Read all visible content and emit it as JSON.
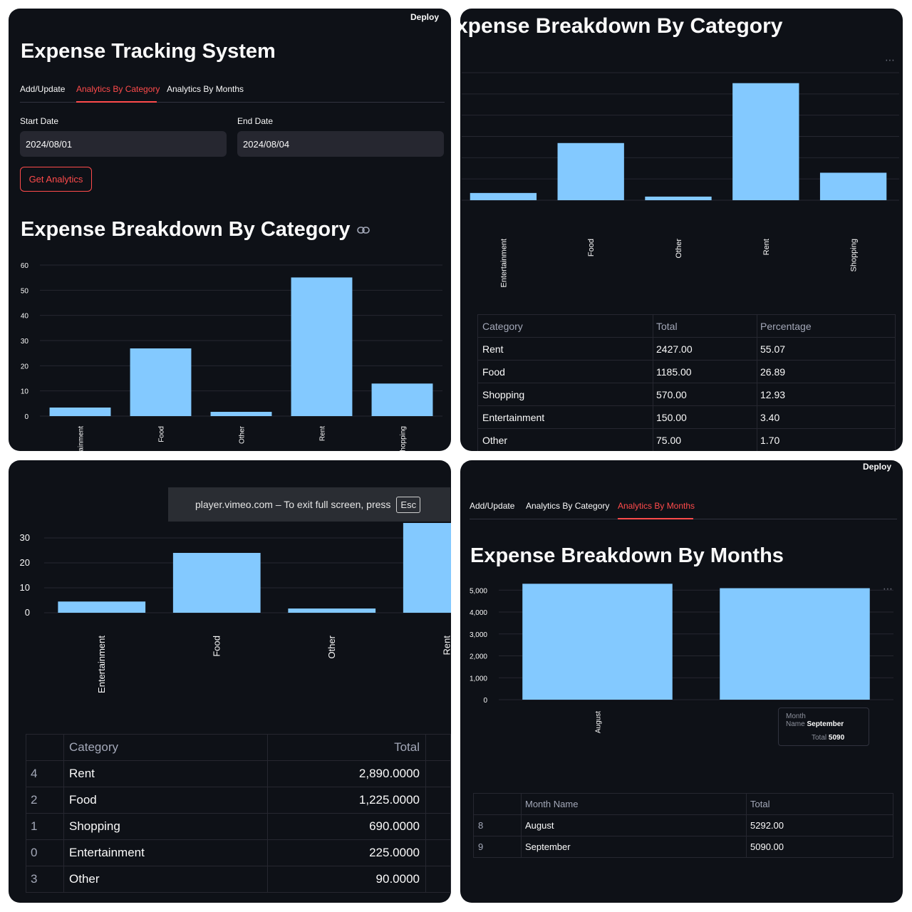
{
  "panel1": {
    "deploy": "Deploy",
    "title": "Expense Tracking System",
    "tabs": [
      {
        "label": "Add/Update",
        "active": false
      },
      {
        "label": "Analytics By Category",
        "active": true
      },
      {
        "label": "Analytics By Months",
        "active": false
      }
    ],
    "start_date_label": "Start Date",
    "start_date_value": "2024/08/01",
    "end_date_label": "End Date",
    "end_date_value": "2024/08/04",
    "get_analytics_button": "Get Analytics",
    "section_title": "Expense Breakdown By Category",
    "link_icon": "link-icon"
  },
  "panel2": {
    "section_title_partial": "xpense Breakdown By Category",
    "more_icon": "more-horizontal-icon",
    "table": {
      "headers": [
        "Category",
        "Total",
        "Percentage"
      ],
      "rows": [
        [
          "Rent",
          "2427.00",
          "55.07"
        ],
        [
          "Food",
          "1185.00",
          "26.89"
        ],
        [
          "Shopping",
          "570.00",
          "12.93"
        ],
        [
          "Entertainment",
          "150.00",
          "3.40"
        ],
        [
          "Other",
          "75.00",
          "1.70"
        ]
      ]
    }
  },
  "panel3": {
    "toast_text": "player.vimeo.com – To exit full screen, press",
    "toast_key": "Esc",
    "table": {
      "headers": [
        "",
        "Category",
        "Total"
      ],
      "rows": [
        [
          "4",
          "Rent",
          "2,890.0000"
        ],
        [
          "2",
          "Food",
          "1,225.0000"
        ],
        [
          "1",
          "Shopping",
          "690.0000"
        ],
        [
          "0",
          "Entertainment",
          "225.0000"
        ],
        [
          "3",
          "Other",
          "90.0000"
        ]
      ]
    }
  },
  "panel4": {
    "deploy": "Deploy",
    "tabs": [
      {
        "label": "Add/Update",
        "active": false
      },
      {
        "label": "Analytics By Category",
        "active": false
      },
      {
        "label": "Analytics By Months",
        "active": true
      }
    ],
    "section_title": "Expense Breakdown By Months",
    "more_icon": "more-horizontal-icon",
    "tooltip": {
      "key1": "Month Name",
      "val1": "September",
      "key2": "Total",
      "val2": "5090"
    },
    "table": {
      "headers": [
        "",
        "Month Name",
        "Total"
      ],
      "rows": [
        [
          "8",
          "August",
          "5292.00"
        ],
        [
          "9",
          "September",
          "5090.00"
        ]
      ]
    }
  },
  "chart_data": [
    {
      "id": "chart1",
      "type": "bar",
      "categories": [
        "Entertainment",
        "Food",
        "Other",
        "Rent",
        "Shopping"
      ],
      "values": [
        3.4,
        26.89,
        1.7,
        55.07,
        12.93
      ],
      "yticks": [
        "0",
        "10",
        "20",
        "30",
        "40",
        "50",
        "60"
      ],
      "ylim": [
        0,
        60
      ],
      "color": "#83c9ff",
      "grid": true
    },
    {
      "id": "chart2",
      "type": "bar",
      "categories": [
        "Entertainment",
        "Food",
        "Other",
        "Rent",
        "Shopping"
      ],
      "values": [
        3.4,
        26.89,
        1.7,
        55.07,
        12.93
      ],
      "ylim": [
        0,
        60
      ],
      "color": "#83c9ff",
      "grid": true
    },
    {
      "id": "chart3",
      "type": "bar",
      "categories": [
        "Entertainment",
        "Food",
        "Other",
        "Rent"
      ],
      "values": [
        4.5,
        24,
        1.7,
        36
      ],
      "yticks": [
        "0",
        "10",
        "20",
        "30"
      ],
      "ylim": [
        0,
        36
      ],
      "color": "#83c9ff",
      "grid": true
    },
    {
      "id": "chart4",
      "type": "bar",
      "categories": [
        "August",
        "Septe"
      ],
      "values": [
        5292,
        5090
      ],
      "yticks": [
        "0",
        "1,000",
        "2,000",
        "3,000",
        "4,000",
        "5,000"
      ],
      "ylim": [
        0,
        5400
      ],
      "color": "#83c9ff",
      "grid": true
    }
  ]
}
